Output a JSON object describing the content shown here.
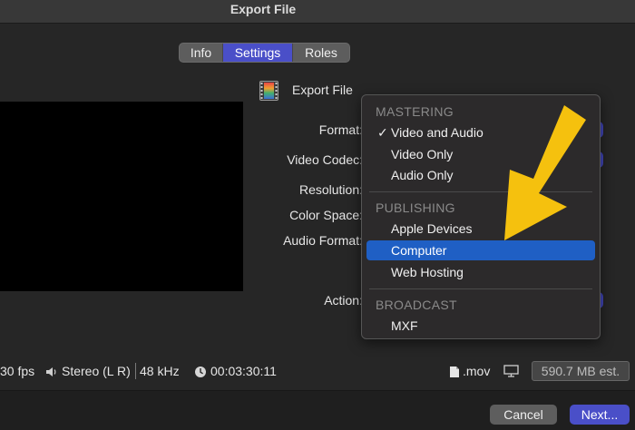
{
  "window": {
    "title": "Export File"
  },
  "tabs": [
    {
      "label": "Info"
    },
    {
      "label": "Settings"
    },
    {
      "label": "Roles"
    }
  ],
  "export": {
    "label": "Export File"
  },
  "form": {
    "format_label": "Format:",
    "video_codec_label": "Video Codec:",
    "resolution_label": "Resolution:",
    "color_space_label": "Color Space:",
    "audio_format_label": "Audio Format:",
    "action_label": "Action:"
  },
  "menu": {
    "sections": [
      {
        "header": "MASTERING",
        "items": [
          {
            "label": "Video and Audio",
            "checked": true
          },
          {
            "label": "Video Only"
          },
          {
            "label": "Audio Only"
          }
        ]
      },
      {
        "header": "PUBLISHING",
        "items": [
          {
            "label": "Apple Devices"
          },
          {
            "label": "Computer",
            "highlighted": true
          },
          {
            "label": "Web Hosting"
          }
        ]
      },
      {
        "header": "BROADCAST",
        "items": [
          {
            "label": "MXF"
          }
        ]
      }
    ],
    "checkmark": "✓"
  },
  "status": {
    "fps": "30 fps",
    "audio": "Stereo (L R)",
    "sample_rate": "48 kHz",
    "duration": "00:03:30:11",
    "file_type": ".mov",
    "size_estimate": "590.7 MB est."
  },
  "buttons": {
    "cancel": "Cancel",
    "next": "Next..."
  },
  "colors": {
    "accent": "#4a4fc8",
    "menu_highlight": "#1f5fc4",
    "annotation_arrow": "#f5c10e"
  }
}
